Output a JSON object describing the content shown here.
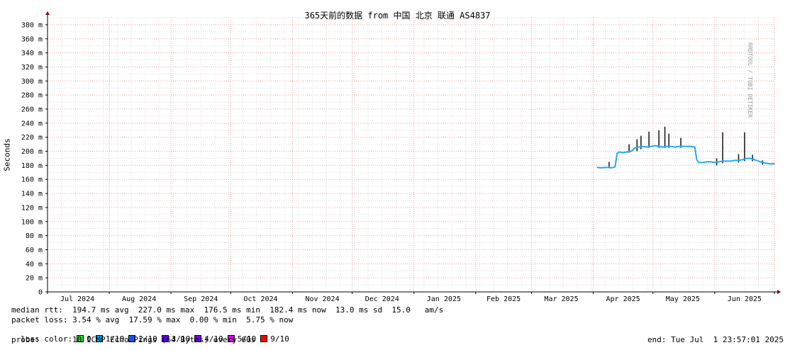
{
  "chart_data": {
    "type": "line",
    "title": "365天前的数据 from 中国 北京 联通 AS4837",
    "ylabel": "Seconds",
    "vendor_text": "RRDTOOL / TOBI OETIKER",
    "ylim": [
      0,
      390
    ],
    "y_ticks": [
      {
        "v": 0,
        "label": "0"
      },
      {
        "v": 20,
        "label": "20 m"
      },
      {
        "v": 40,
        "label": "40 m"
      },
      {
        "v": 60,
        "label": "60 m"
      },
      {
        "v": 80,
        "label": "80 m"
      },
      {
        "v": 100,
        "label": "100 m"
      },
      {
        "v": 120,
        "label": "120 m"
      },
      {
        "v": 140,
        "label": "140 m"
      },
      {
        "v": 160,
        "label": "160 m"
      },
      {
        "v": 180,
        "label": "180 m"
      },
      {
        "v": 200,
        "label": "200 m"
      },
      {
        "v": 220,
        "label": "220 m"
      },
      {
        "v": 240,
        "label": "240 m"
      },
      {
        "v": 260,
        "label": "260 m"
      },
      {
        "v": 280,
        "label": "280 m"
      },
      {
        "v": 300,
        "label": "300 m"
      },
      {
        "v": 320,
        "label": "320 m"
      },
      {
        "v": 340,
        "label": "340 m"
      },
      {
        "v": 360,
        "label": "360 m"
      },
      {
        "v": 380,
        "label": "380 m"
      }
    ],
    "xlim": [
      "2024-07-01",
      "2025-07-01"
    ],
    "month_starts": [
      "2024-07-01",
      "2024-08-01",
      "2024-09-01",
      "2024-10-01",
      "2024-11-01",
      "2024-12-01",
      "2025-01-01",
      "2025-02-01",
      "2025-03-01",
      "2025-04-01",
      "2025-05-01",
      "2025-06-01",
      "2025-07-01"
    ],
    "x_ticks": [
      {
        "date": "2024-07-16",
        "label": "Jul 2024"
      },
      {
        "date": "2024-08-16",
        "label": "Aug 2024"
      },
      {
        "date": "2024-09-16",
        "label": "Sep 2024"
      },
      {
        "date": "2024-10-16",
        "label": "Oct 2024"
      },
      {
        "date": "2024-11-16",
        "label": "Nov 2024"
      },
      {
        "date": "2024-12-16",
        "label": "Dec 2024"
      },
      {
        "date": "2025-01-16",
        "label": "Jan 2025"
      },
      {
        "date": "2025-02-15",
        "label": "Feb 2025"
      },
      {
        "date": "2025-03-16",
        "label": "Mar 2025"
      },
      {
        "date": "2025-04-16",
        "label": "Apr 2025"
      },
      {
        "date": "2025-05-16",
        "label": "May 2025"
      },
      {
        "date": "2025-06-16",
        "label": "Jun 2025"
      }
    ],
    "series": [
      {
        "color": "#22aaee",
        "points": [
          [
            "2025-04-03",
            177
          ],
          [
            "2025-04-05",
            176.5
          ],
          [
            "2025-04-07",
            177
          ],
          [
            "2025-04-09",
            177
          ],
          [
            "2025-04-10",
            176.5
          ],
          [
            "2025-04-11",
            177
          ],
          [
            "2025-04-12",
            178
          ],
          [
            "2025-04-13",
            197
          ],
          [
            "2025-04-14",
            199
          ],
          [
            "2025-04-16",
            198
          ],
          [
            "2025-04-18",
            199
          ],
          [
            "2025-04-20",
            200
          ],
          [
            "2025-04-21",
            202
          ],
          [
            "2025-04-22",
            205
          ],
          [
            "2025-04-24",
            206
          ],
          [
            "2025-04-26",
            207
          ],
          [
            "2025-04-28",
            206
          ],
          [
            "2025-04-30",
            207
          ],
          [
            "2025-05-02",
            208
          ],
          [
            "2025-05-04",
            207
          ],
          [
            "2025-05-06",
            206
          ],
          [
            "2025-05-08",
            207
          ],
          [
            "2025-05-10",
            207
          ],
          [
            "2025-05-12",
            206
          ],
          [
            "2025-05-14",
            207
          ],
          [
            "2025-05-16",
            207
          ],
          [
            "2025-05-18",
            207
          ],
          [
            "2025-05-20",
            207
          ],
          [
            "2025-05-22",
            206
          ],
          [
            "2025-05-23",
            188
          ],
          [
            "2025-05-24",
            184
          ],
          [
            "2025-05-26",
            184
          ],
          [
            "2025-05-28",
            185
          ],
          [
            "2025-05-30",
            185
          ],
          [
            "2025-06-01",
            184
          ],
          [
            "2025-06-03",
            185
          ],
          [
            "2025-06-05",
            186
          ],
          [
            "2025-06-07",
            186
          ],
          [
            "2025-06-09",
            186
          ],
          [
            "2025-06-11",
            187
          ],
          [
            "2025-06-13",
            187
          ],
          [
            "2025-06-15",
            188
          ],
          [
            "2025-06-17",
            190
          ],
          [
            "2025-06-19",
            190
          ],
          [
            "2025-06-21",
            188
          ],
          [
            "2025-06-23",
            186
          ],
          [
            "2025-06-25",
            184
          ],
          [
            "2025-06-27",
            183
          ],
          [
            "2025-06-29",
            182
          ],
          [
            "2025-07-01",
            182.4
          ]
        ]
      }
    ],
    "spikes": [
      {
        "date": "2025-04-09",
        "min": 176,
        "max": 185
      },
      {
        "date": "2025-04-19",
        "min": 198,
        "max": 210
      },
      {
        "date": "2025-04-23",
        "min": 200,
        "max": 217
      },
      {
        "date": "2025-04-25",
        "min": 203,
        "max": 222
      },
      {
        "date": "2025-04-29",
        "min": 205,
        "max": 228
      },
      {
        "date": "2025-05-04",
        "min": 205,
        "max": 230
      },
      {
        "date": "2025-05-07",
        "min": 205,
        "max": 235
      },
      {
        "date": "2025-05-09",
        "min": 205,
        "max": 225
      },
      {
        "date": "2025-05-15",
        "min": 205,
        "max": 219
      },
      {
        "date": "2025-06-02",
        "min": 180,
        "max": 190
      },
      {
        "date": "2025-06-05",
        "min": 183,
        "max": 227
      },
      {
        "date": "2025-06-13",
        "min": 184,
        "max": 196
      },
      {
        "date": "2025-06-16",
        "min": 186,
        "max": 227
      },
      {
        "date": "2025-06-20",
        "min": 186,
        "max": 195
      },
      {
        "date": "2025-06-25",
        "min": 181,
        "max": 187
      }
    ],
    "grid": true
  },
  "legend": {
    "median_rtt": "median rtt:  194.7 ms avg  227.0 ms max  176.5 ms min  182.4 ms now  13.0 ms sd  15.0   am/s",
    "packet_loss": "packet loss: 3.54 % avg  17.59 % max  0.00 % min  5.75 % now",
    "loss_color_label": "loss color:",
    "loss_colors": [
      {
        "label": "0",
        "color": "#26e826"
      },
      {
        "label": "1/10",
        "color": "#00b8ff"
      },
      {
        "label": "2/10",
        "color": "#0059ff"
      },
      {
        "label": "3/10",
        "color": "#5e00ff"
      },
      {
        "label": "4/10",
        "color": "#7e00ff"
      },
      {
        "label": "5/10",
        "color": "#dd00ff"
      },
      {
        "label": "9/10",
        "color": "#ff0000"
      }
    ],
    "probe": "probe:       10 ICMP Echo Pings (64 Bytes) every 60s",
    "end": "end: Tue Jul  1 23:57:01 2025"
  }
}
